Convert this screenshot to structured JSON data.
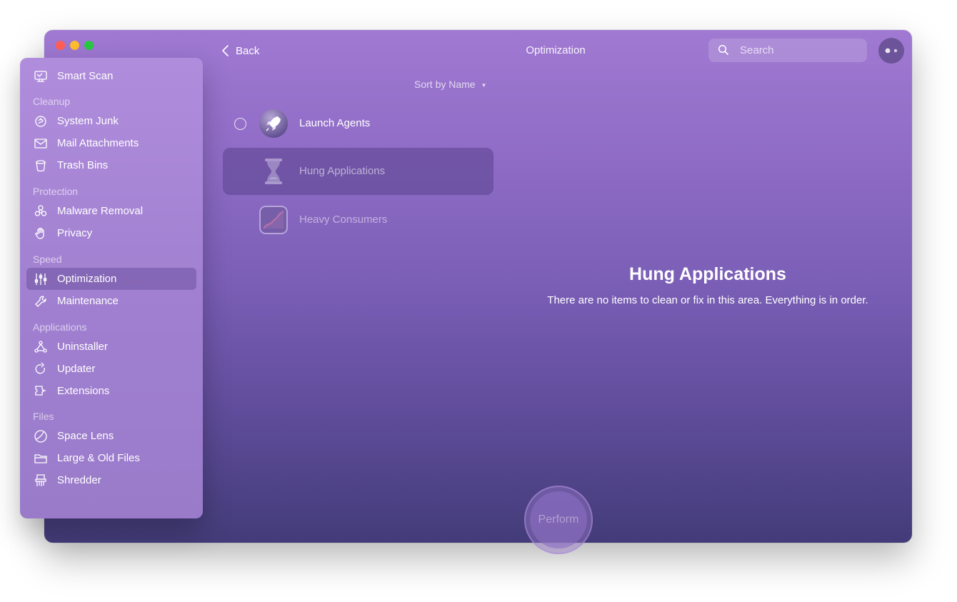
{
  "window": {
    "title": "Optimization",
    "back_label": "Back",
    "traffic_colors": [
      "#fe5f57",
      "#febc2e",
      "#28c840"
    ]
  },
  "search": {
    "placeholder": "Search",
    "value": ""
  },
  "sidebar": {
    "smart_scan": {
      "label": "Smart Scan",
      "icon": "monitor-scan-icon"
    },
    "sections": [
      {
        "title": "Cleanup",
        "items": [
          {
            "label": "System Junk",
            "icon": "system-junk-icon"
          },
          {
            "label": "Mail Attachments",
            "icon": "envelope-icon"
          },
          {
            "label": "Trash Bins",
            "icon": "trash-bin-icon"
          }
        ]
      },
      {
        "title": "Protection",
        "items": [
          {
            "label": "Malware Removal",
            "icon": "biohazard-icon"
          },
          {
            "label": "Privacy",
            "icon": "hand-icon"
          }
        ]
      },
      {
        "title": "Speed",
        "items": [
          {
            "label": "Optimization",
            "icon": "sliders-icon",
            "active": true
          },
          {
            "label": "Maintenance",
            "icon": "wrench-icon"
          }
        ]
      },
      {
        "title": "Applications",
        "items": [
          {
            "label": "Uninstaller",
            "icon": "uninstaller-icon"
          },
          {
            "label": "Updater",
            "icon": "updater-arrow-icon"
          },
          {
            "label": "Extensions",
            "icon": "extensions-icon"
          }
        ]
      },
      {
        "title": "Files",
        "items": [
          {
            "label": "Space Lens",
            "icon": "space-lens-icon"
          },
          {
            "label": "Large & Old Files",
            "icon": "folder-icon"
          },
          {
            "label": "Shredder",
            "icon": "shredder-icon"
          }
        ]
      }
    ]
  },
  "list": {
    "sort_label": "Sort by Name",
    "items": [
      {
        "label": "Launch Agents",
        "icon": "rocket-icon",
        "state": "normal"
      },
      {
        "label": "Hung Applications",
        "icon": "hourglass-icon",
        "state": "selected"
      },
      {
        "label": "Heavy Consumers",
        "icon": "activity-graph-icon",
        "state": "dimmed"
      }
    ]
  },
  "detail": {
    "title": "Hung Applications",
    "message": "There are no items to clean or fix in this area. Everything is in order."
  },
  "perform": {
    "label": "Perform",
    "enabled": false
  },
  "colors": {
    "window_top": "#a079d2",
    "window_bottom": "#433c79",
    "sidebar": "#a585d4",
    "selection": "#5a428c"
  }
}
